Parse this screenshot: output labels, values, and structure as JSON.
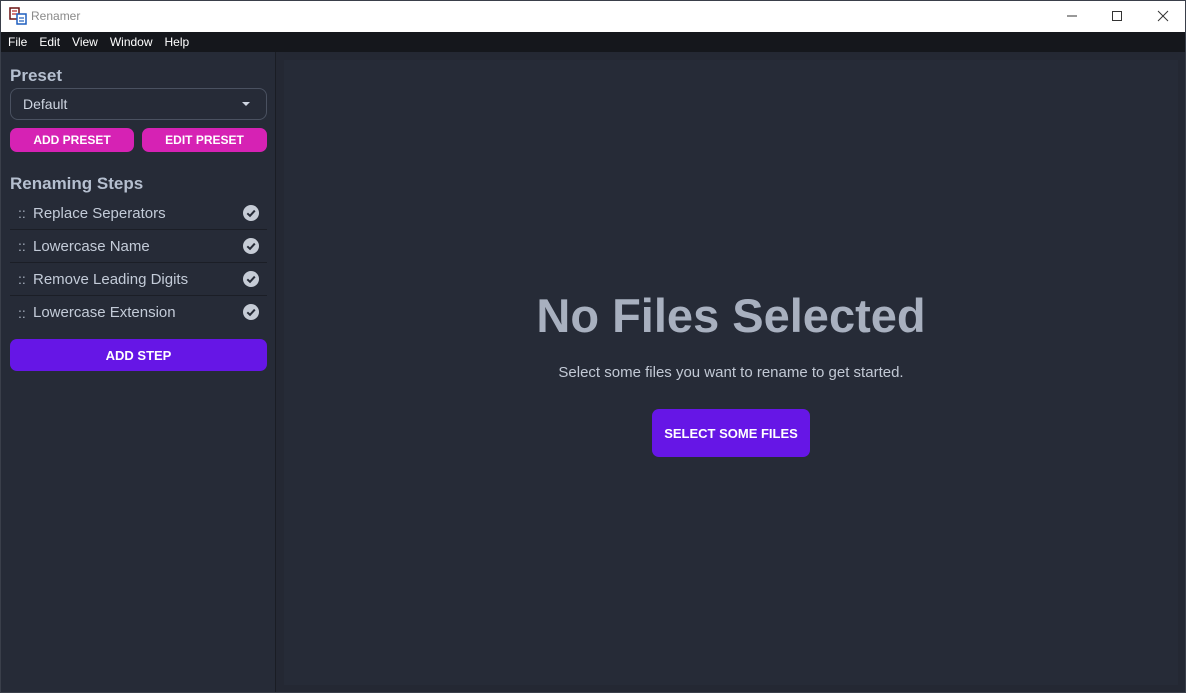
{
  "window": {
    "title": "Renamer"
  },
  "menu": [
    "File",
    "Edit",
    "View",
    "Window",
    "Help"
  ],
  "sidebar": {
    "preset_heading": "Preset",
    "preset_value": "Default",
    "add_preset_label": "ADD PRESET",
    "edit_preset_label": "EDIT PRESET",
    "steps_heading": "Renaming Steps",
    "drag_glyph": "::",
    "steps": [
      {
        "label": "Replace Seperators",
        "enabled": true
      },
      {
        "label": "Lowercase Name",
        "enabled": true
      },
      {
        "label": "Remove Leading Digits",
        "enabled": true
      },
      {
        "label": "Lowercase Extension",
        "enabled": true
      }
    ],
    "add_step_label": "ADD STEP"
  },
  "main": {
    "empty_title": "No Files Selected",
    "empty_subtitle": "Select some files you want to rename to get started.",
    "select_files_label": "SELECT SOME FILES"
  },
  "colors": {
    "accent_purple": "#6616e6",
    "accent_pink": "#d622b4",
    "panel_bg": "#262b37",
    "menu_bg": "#15171c"
  }
}
